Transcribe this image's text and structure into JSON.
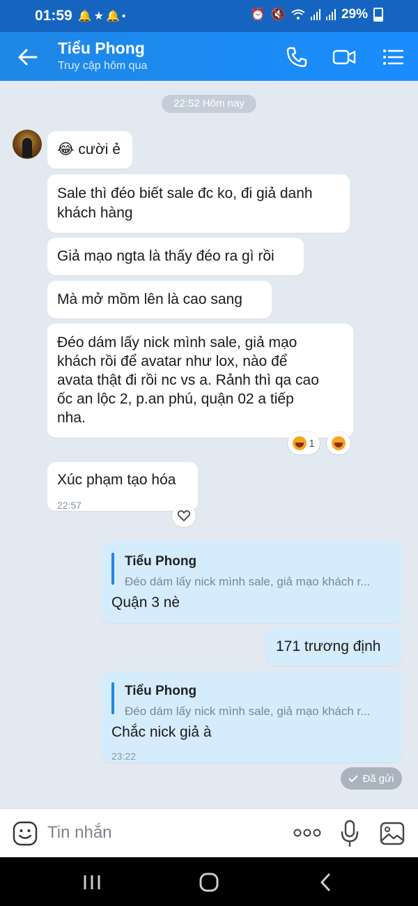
{
  "status_bar": {
    "time": "01:59",
    "battery": "29%",
    "notification_icons": [
      "notification-bell-icon",
      "star-icon",
      "notification-bell-icon",
      "dot-icon"
    ],
    "right_icons": [
      "alarm-icon",
      "mute-icon",
      "wifi-icon",
      "signal-icon",
      "signal-icon",
      "battery-icon"
    ]
  },
  "header": {
    "name": "Tiểu Phong",
    "status": "Truy cập hôm qua",
    "accent": "#1e88e5"
  },
  "chat": {
    "date_pill": "22:52 Hôm nay",
    "messages": [
      {
        "from": "them",
        "text": "cười ẻ",
        "emoji": "tears-of-joy-icon"
      },
      {
        "from": "them",
        "lines": [
          "Sale thì đéo biết sale đc ko, đi giả danh",
          "khách hàng"
        ]
      },
      {
        "from": "them",
        "text": "Giả mạo ngta là thấy đéo ra gì rồi"
      },
      {
        "from": "them",
        "text": "Mà mở mồm lên là cao sang"
      },
      {
        "from": "them",
        "lines": [
          "Đéo dám lấy nick mình sale, giả mạo",
          "khách rồi để avatar như lox, nào để",
          "avata thật đi rồi nc vs a. Rảnh thì qa cao",
          "ốc an lộc 2, p.an phú,  quận 02 a tiếp",
          "nha."
        ],
        "reaction_count": "1"
      },
      {
        "from": "them",
        "text": "Xúc phạm tạo hóa",
        "time": "22:57"
      },
      {
        "from": "me",
        "reply_name": "Tiểu Phong",
        "reply_text": "Đéo dám lấy nick mình sale, giả mạo khách r...",
        "text": "Quận 3 nè"
      },
      {
        "from": "me",
        "text": "171 trương định"
      },
      {
        "from": "me",
        "reply_name": "Tiểu Phong",
        "reply_text": "Đéo dám lấy nick mình sale, giả mạo khách r...",
        "text": "Chắc nick giả à",
        "time": "23:22"
      }
    ],
    "sent_status": "Đã gửi"
  },
  "input": {
    "placeholder": "Tin nhắn"
  }
}
